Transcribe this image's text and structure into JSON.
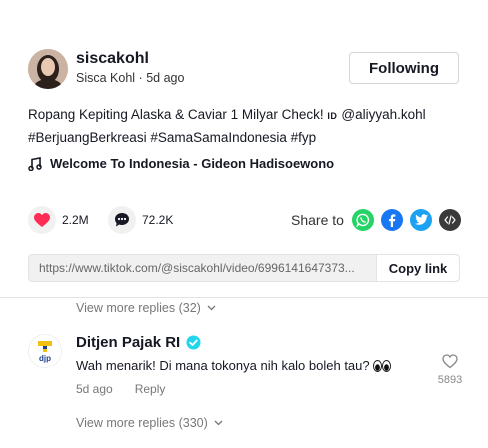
{
  "post": {
    "username": "siscakohl",
    "display_name": "Sisca Kohl",
    "time_ago": "5d ago",
    "subline_sep": "·",
    "follow_label": "Following",
    "caption": "Ropang Kepiting Alaska & Caviar 1 Milyar Check! ",
    "caption_id_tag": "ID",
    "caption_mention": "@aliyyah.kohl",
    "caption_line2": "#BerjuangBerkreasi #SamaSamaIndonesia #fyp",
    "music": "Welcome To Indonesia - Gideon Hadisoewono",
    "likes": "2.2M",
    "comments": "72.2K",
    "share_label": "Share to",
    "link_url": "https://www.tiktok.com/@siscakohl/video/6996141647373...",
    "copy_label": "Copy link"
  },
  "comments": {
    "view_more_top": "View more replies (32)",
    "reply": {
      "username": "Ditjen Pajak RI",
      "text": "Wah menarik! Di mana tokonya nih kalo boleh tau? ",
      "time_ago": "5d ago",
      "reply_label": "Reply",
      "like_count": "5893",
      "avatar_text": "djp"
    },
    "view_more_bottom": "View more replies (330)"
  },
  "colors": {
    "like_heart": "#fe2c55",
    "whatsapp": "#25d366",
    "facebook": "#1877f2",
    "twitter": "#1da1f2",
    "embed": "#3a3a3a",
    "verified": "#20d5ec"
  },
  "icons": {
    "music": "music-note-icon",
    "like": "heart-icon",
    "comment": "comment-bubble-icon",
    "whatsapp": "whatsapp-icon",
    "facebook": "facebook-icon",
    "twitter": "twitter-icon",
    "embed": "embed-code-icon",
    "chevron": "chevron-down-icon",
    "verified": "verified-badge-icon",
    "eyes": "eyes-emoji-icon",
    "comment_like": "heart-outline-icon"
  }
}
